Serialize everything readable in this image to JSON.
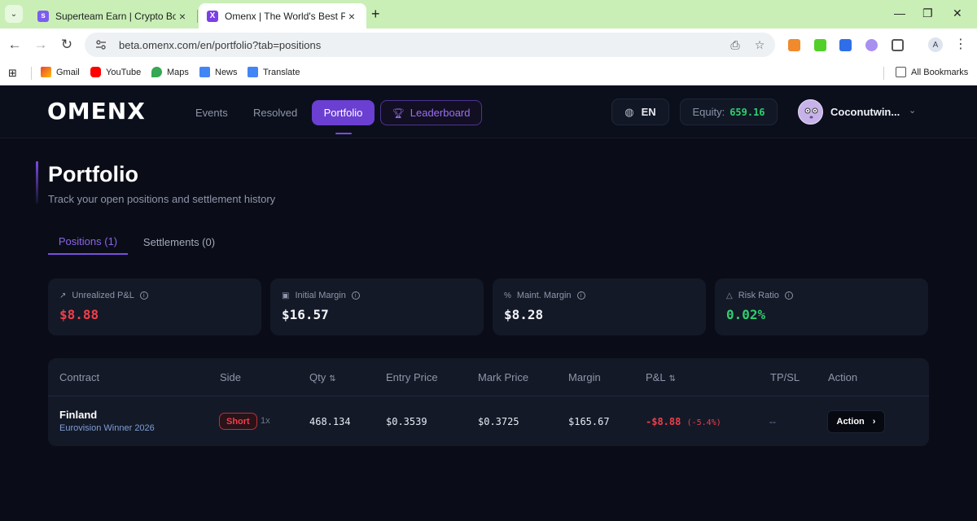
{
  "browser": {
    "tabs": [
      {
        "title": "Superteam Earn | Crypto Bounties",
        "active": false
      },
      {
        "title": "Omenx | The World's Best Prediction",
        "active": true
      }
    ],
    "url": "beta.omenx.com/en/portfolio?tab=positions",
    "bookmarks": [
      "Gmail",
      "YouTube",
      "Maps",
      "News",
      "Translate"
    ],
    "all_bookmarks": "All Bookmarks",
    "profile_initial": "A"
  },
  "header": {
    "logo": "OMENX",
    "nav": {
      "events": "Events",
      "resolved": "Resolved",
      "portfolio": "Portfolio",
      "leaderboard": "Leaderboard"
    },
    "language": "EN",
    "equity_label": "Equity:",
    "equity_value": "659.16",
    "username": "Coconutwin..."
  },
  "page": {
    "title": "Portfolio",
    "subtitle": "Track your open positions and settlement history",
    "tabs": {
      "positions": "Positions (1)",
      "settlements": "Settlements (0)"
    }
  },
  "stats": {
    "unrealized_pnl": {
      "label": "Unrealized P&L",
      "value": "$8.88"
    },
    "initial_margin": {
      "label": "Initial Margin",
      "value": "$16.57"
    },
    "maint_margin": {
      "label": "Maint. Margin",
      "value": "$8.28"
    },
    "risk_ratio": {
      "label": "Risk Ratio",
      "value": "0.02%"
    }
  },
  "table": {
    "headers": {
      "contract": "Contract",
      "side": "Side",
      "qty": "Qty",
      "entry": "Entry Price",
      "mark": "Mark Price",
      "margin": "Margin",
      "pnl": "P&L",
      "tpsl": "TP/SL",
      "action": "Action"
    },
    "rows": [
      {
        "contract": "Finland",
        "market": "Eurovision Winner 2026",
        "side": "Short",
        "leverage": "1x",
        "qty": "468.134",
        "entry": "$0.3539",
        "mark": "$0.3725",
        "margin": "$165.67",
        "pnl": "-$8.88",
        "pnl_pct": "(-5.4%)",
        "tpsl": "--",
        "action": "Action"
      }
    ]
  },
  "colors": {
    "accent": "#6a3fd1",
    "loss": "#ef3f4a",
    "gain": "#2fcf6e",
    "background": "#0a0d18",
    "card": "#141927"
  }
}
